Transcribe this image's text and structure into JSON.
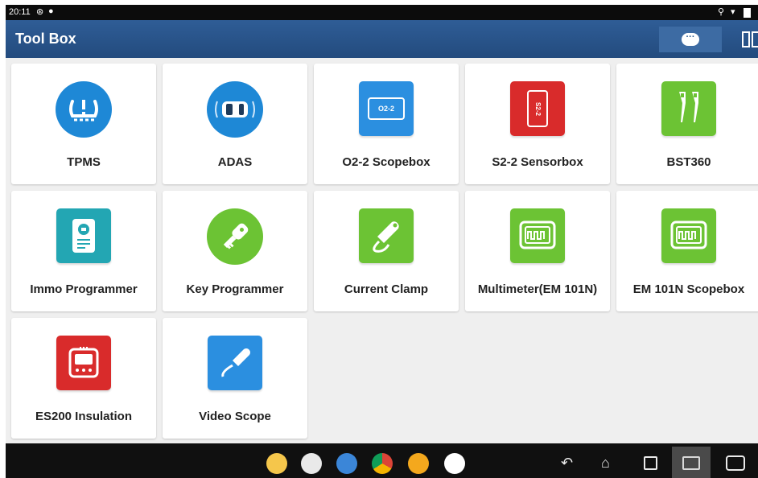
{
  "status_bar": {
    "time": "20:11"
  },
  "app_bar": {
    "title": "Tool Box"
  },
  "tools": [
    {
      "label": "TPMS",
      "icon": "tpms-icon"
    },
    {
      "label": "ADAS",
      "icon": "adas-car-icon"
    },
    {
      "label": "O2-2 Scopebox",
      "icon": "scopebox-icon",
      "badge": "O2-2"
    },
    {
      "label": "S2-2 Sensorbox",
      "icon": "sensorbox-icon",
      "badge": "S2-2"
    },
    {
      "label": "BST360",
      "icon": "battery-tester-icon"
    },
    {
      "label": "Immo Programmer",
      "icon": "immo-programmer-icon"
    },
    {
      "label": "Key Programmer",
      "icon": "key-icon"
    },
    {
      "label": "Current Clamp",
      "icon": "current-clamp-icon"
    },
    {
      "label": "Multimeter(EM 101N)",
      "icon": "multimeter-icon"
    },
    {
      "label": "EM 101N Scopebox",
      "icon": "oscilloscope-icon"
    },
    {
      "label": "ES200 Insulation",
      "icon": "insulation-tester-icon"
    },
    {
      "label": "Video Scope",
      "icon": "video-scope-icon"
    }
  ],
  "colors": {
    "app_bar": "#2a5689",
    "tpms": "#1e88d6",
    "scopebox": "#2b8fe0",
    "sensorbox": "#d92b2b",
    "green": "#6cc334",
    "teal": "#23a6b3"
  },
  "nav": {
    "dock_apps": [
      "mail-icon",
      "gallery-icon",
      "photos-icon",
      "chrome-icon",
      "camera-icon",
      "app-drawer-icon"
    ],
    "buttons": [
      "back-icon",
      "home-icon",
      "recents-icon",
      "screenshot-icon",
      "vci-icon"
    ]
  }
}
